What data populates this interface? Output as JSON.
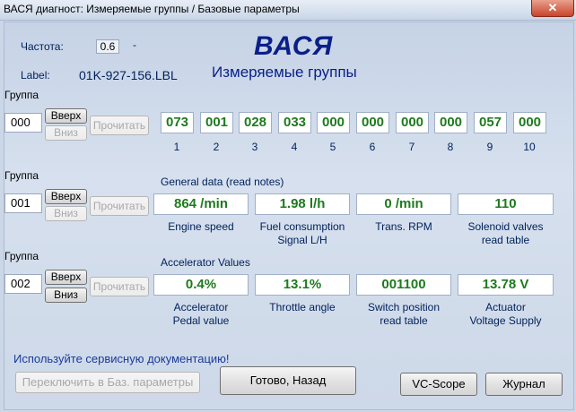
{
  "window": {
    "title": "ВАСЯ диагност: Измеряемые группы / Базовые параметры",
    "close_glyph": "✕"
  },
  "header": {
    "freq_label": "Частота:",
    "freq_value": "0.6",
    "freq_dash": "-",
    "label_label": "Label:",
    "label_value": "01K-927-156.LBL",
    "brand": "ВАСЯ",
    "subtitle": "Измеряемые группы"
  },
  "buttons": {
    "up": "Вверх",
    "down": "Вниз",
    "read": "Прочитать"
  },
  "group_label": "Группа",
  "group1": {
    "number": "000",
    "cells": [
      "073",
      "001",
      "028",
      "033",
      "000",
      "000",
      "000",
      "000",
      "057",
      "000"
    ],
    "indices": [
      "1",
      "2",
      "3",
      "4",
      "5",
      "6",
      "7",
      "8",
      "9",
      "10"
    ]
  },
  "group2": {
    "number": "001",
    "title": "General data (read notes)",
    "items": [
      {
        "value": "864 /min",
        "label1": "Engine speed",
        "label2": ""
      },
      {
        "value": "1.98 l/h",
        "label1": "Fuel consumption",
        "label2": "Signal L/H"
      },
      {
        "value": "0 /min",
        "label1": "Trans. RPM",
        "label2": ""
      },
      {
        "value": "110",
        "label1": "Solenoid valves",
        "label2": "read table"
      }
    ]
  },
  "group3": {
    "number": "002",
    "title": "Accelerator Values",
    "items": [
      {
        "value": "0.4%",
        "label1": "Accelerator",
        "label2": "Pedal value"
      },
      {
        "value": "13.1%",
        "label1": "Throttle angle",
        "label2": ""
      },
      {
        "value": "001100",
        "label1": "Switch position",
        "label2": "read table"
      },
      {
        "value": "13.78 V",
        "label1": "Actuator",
        "label2": "Voltage Supply"
      }
    ]
  },
  "footer": {
    "notice": "Используйте сервисную документацию!",
    "switch_basic": "Переключить в Баз. параметры",
    "done_back": "Готово, Назад",
    "vcscope": "VC-Scope",
    "journal": "Журнал"
  },
  "colors": {
    "value_text": "#1e7a1e",
    "label_text": "#00205a",
    "brand": "#0a1f88",
    "background": "#cbd6e6"
  }
}
